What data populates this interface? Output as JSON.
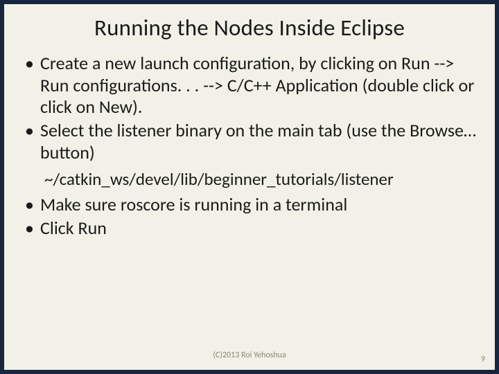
{
  "title": "Running the Nodes Inside Eclipse",
  "bullets_top": [
    "Create a new launch configuration, by clicking on Run --> Run configurations. . . --> C/C++ Application (double click or click on New).",
    "Select the listener binary on the main tab (use the Browse… button)"
  ],
  "path": "~/catkin_ws/devel/lib/beginner_tutorials/listener",
  "bullets_bottom": [
    "Make sure roscore is running in a terminal",
    "Click Run"
  ],
  "footer": {
    "copyright": "(C)2013 Roi Yehoshua",
    "page": "9"
  }
}
